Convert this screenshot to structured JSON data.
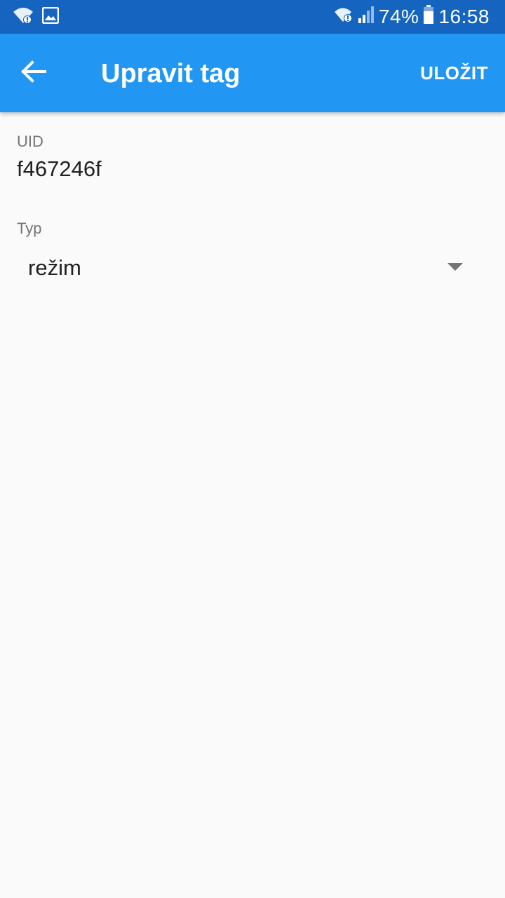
{
  "status_bar": {
    "battery_percent": "74%",
    "time": "16:58",
    "battery_level": 0.74,
    "icons": [
      "wifi-alert-icon",
      "image-icon",
      "wifi-alert-icon",
      "signal-icon",
      "battery-icon"
    ]
  },
  "app_bar": {
    "title": "Upravit tag",
    "save_label": "ULOŽIT",
    "background_color": "#2196f3",
    "status_color": "#1565c0"
  },
  "form": {
    "uid_label": "UID",
    "uid_value": "f467246f",
    "type_label": "Typ",
    "type_selected": "režim"
  }
}
